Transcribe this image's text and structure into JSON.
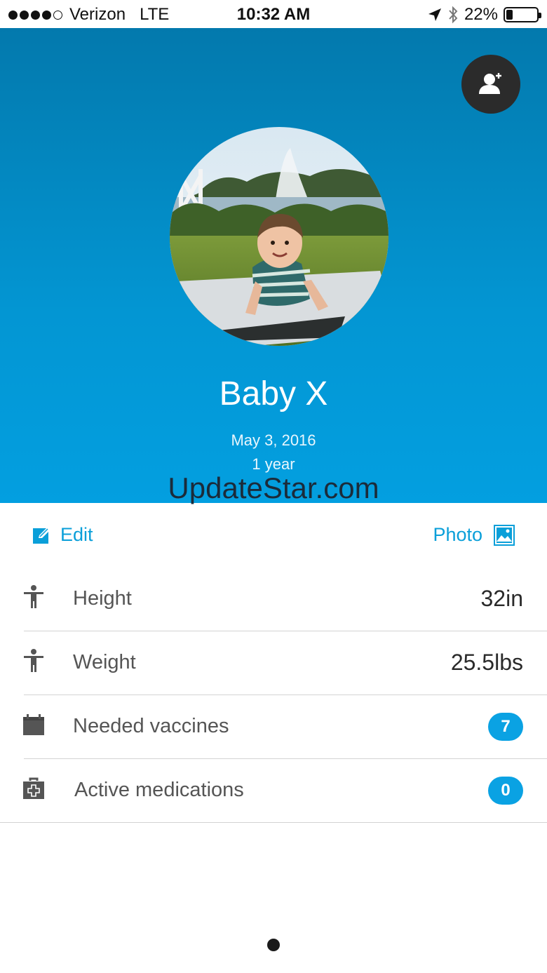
{
  "status_bar": {
    "signal_dots": [
      true,
      true,
      true,
      true,
      false
    ],
    "carrier": "Verizon",
    "network": "LTE",
    "time": "10:32 AM",
    "battery_percent": "22%",
    "battery_level": 0.22,
    "icons": [
      "location-arrow-icon",
      "bluetooth-icon",
      "battery-icon"
    ]
  },
  "profile": {
    "name": "Baby X",
    "birth_date": "May 3, 2016",
    "age": "1 year",
    "add_profile_icon": "add-person-icon"
  },
  "watermark": "UpdateStar.com",
  "actions": {
    "edit_label": "Edit",
    "photo_label": "Photo"
  },
  "rows": [
    {
      "label": "Height",
      "value": "32in",
      "icon": "person-icon"
    },
    {
      "label": "Weight",
      "value": "25.5lbs",
      "icon": "person-icon"
    },
    {
      "label": "Needed vaccines",
      "badge": "7",
      "icon": "calendar-icon"
    },
    {
      "label": "Active medications",
      "badge": "0",
      "icon": "medical-kit-icon"
    }
  ],
  "colors": {
    "header_top": "#0379ad",
    "header_bottom": "#039fe0",
    "accent": "#0a9fd9",
    "badge": "#0aa2e3"
  }
}
